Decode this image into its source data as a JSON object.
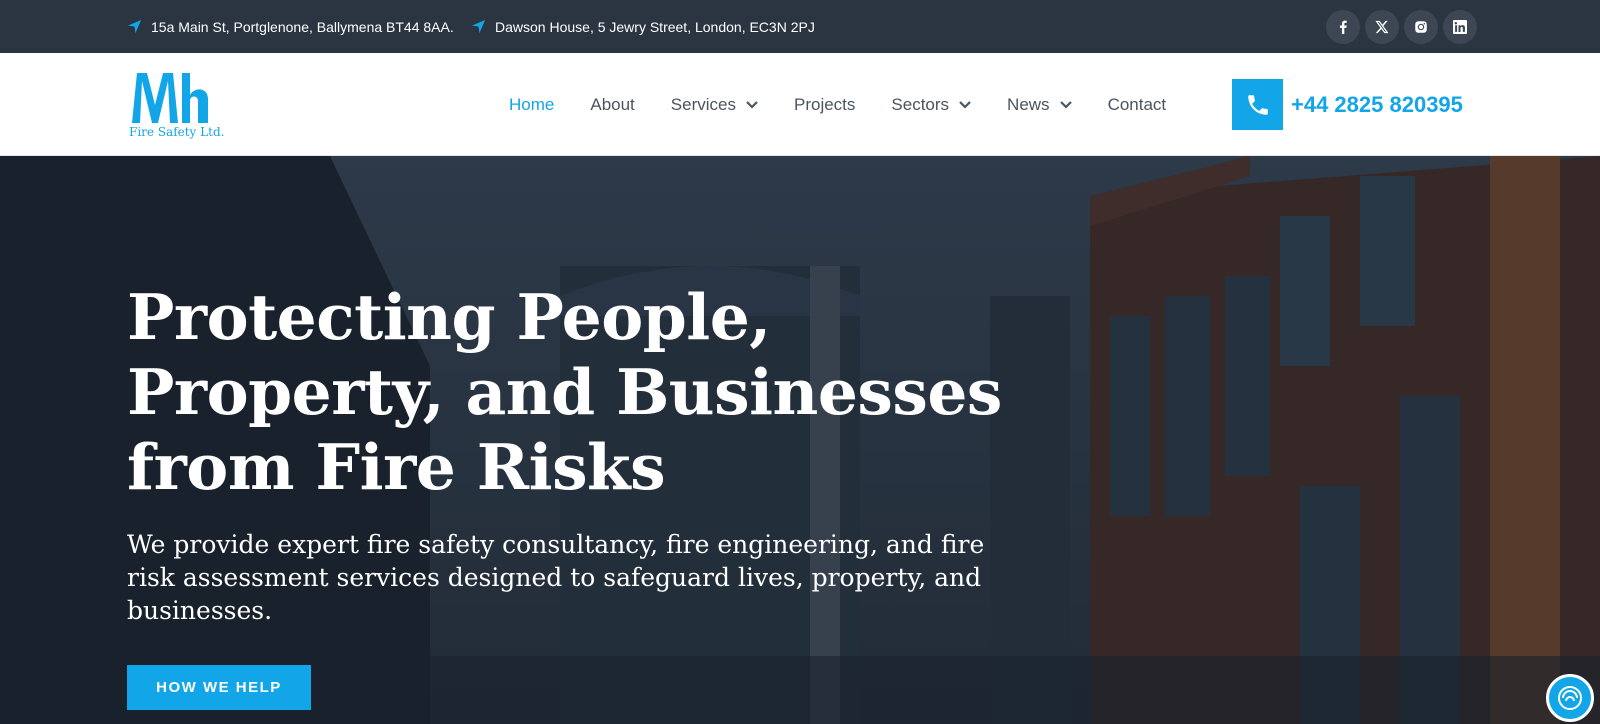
{
  "topbar": {
    "address_1": "15a Main St, Portglenone, Ballymena BT44 8AA.",
    "address_2": "Dawson House, 5 Jewry Street, London, EC3N 2PJ",
    "socials": [
      "facebook-icon",
      "x-icon",
      "instagram-icon",
      "linkedin-icon"
    ]
  },
  "brand": {
    "logo_text": "Mh",
    "tagline": "Fire Safety Ltd.",
    "accent": "#12a5e8"
  },
  "nav": {
    "items": [
      {
        "label": "Home",
        "active": true,
        "dropdown": false
      },
      {
        "label": "About",
        "active": false,
        "dropdown": false
      },
      {
        "label": "Services",
        "active": false,
        "dropdown": true
      },
      {
        "label": "Projects",
        "active": false,
        "dropdown": false
      },
      {
        "label": "Sectors",
        "active": false,
        "dropdown": true
      },
      {
        "label": "News",
        "active": false,
        "dropdown": true
      },
      {
        "label": "Contact",
        "active": false,
        "dropdown": false
      }
    ],
    "phone": "+44 2825 820395"
  },
  "hero": {
    "title": "Protecting People, Property, and Businesses from Fire Risks",
    "subtitle": "We provide expert fire safety consultancy, fire engineering, and fire risk assessment services designed to safeguard lives, property, and businesses.",
    "button_label": "HOW WE HELP"
  },
  "colors": {
    "topbar_bg": "#2a3541",
    "nav_text": "#4a5561",
    "accent": "#12a5e8"
  }
}
